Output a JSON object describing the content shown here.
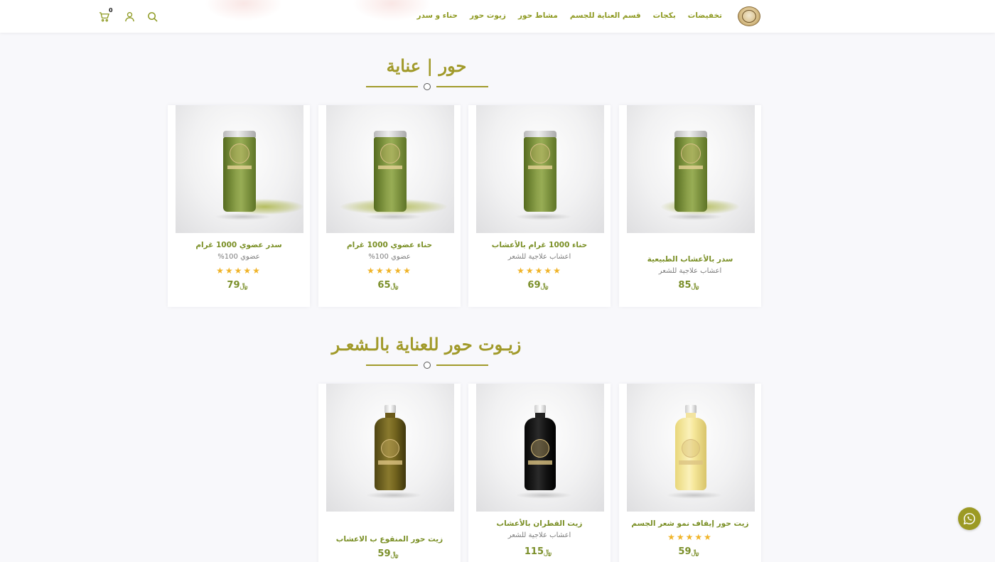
{
  "header": {
    "nav": [
      {
        "label": "حناء و سدر"
      },
      {
        "label": "زيوت حور"
      },
      {
        "label": "مشاط حور"
      },
      {
        "label": "قسم العناية للجسم"
      },
      {
        "label": "بكجات"
      },
      {
        "label": "تخفيضات"
      }
    ],
    "cart_count": "0",
    "icons": [
      "search-icon",
      "user-icon",
      "cart-icon"
    ]
  },
  "sections": [
    {
      "title": "حور | عناية",
      "products": [
        {
          "name": "سدر بالأعشاب الطبيعية",
          "subtitle": "اعشاب علاجية للشعر",
          "rating": 0,
          "price": "85",
          "currency": "﷼"
        },
        {
          "name": "حناء 1000 غرام بالأعشاب",
          "subtitle": "اعشاب علاجية للشعر",
          "rating": 5,
          "price": "69",
          "currency": "﷼"
        },
        {
          "name": "حناء عضوي 1000 غرام",
          "subtitle": "عضوي 100%",
          "rating": 5,
          "price": "65",
          "currency": "﷼"
        },
        {
          "name": "سدر عضوي 1000 غرام",
          "subtitle": "عضوي 100%",
          "rating": 5,
          "price": "79",
          "currency": "﷼"
        }
      ]
    },
    {
      "title": "زيـوت حور للعناية بالـشعـر",
      "products": [
        {
          "name": "زيت حور إيقاف نمو شعر الجسم",
          "subtitle": "",
          "rating": 5,
          "price": "59",
          "currency": "﷼"
        },
        {
          "name": "زيت القطران بالأعشاب",
          "subtitle": "اعشاب علاجية للشعر",
          "rating": 0,
          "price": "115",
          "currency": "﷼"
        },
        {
          "name": "زيت حور المنقوع ب الاعشاب",
          "subtitle": "",
          "rating": 0,
          "price": "59",
          "currency": "﷼"
        }
      ]
    }
  ],
  "colors": {
    "brand_olive": "#a19a2a",
    "product_name": "#7a8f25",
    "star": "#f0b429",
    "whatsapp": "#9c9a24"
  }
}
